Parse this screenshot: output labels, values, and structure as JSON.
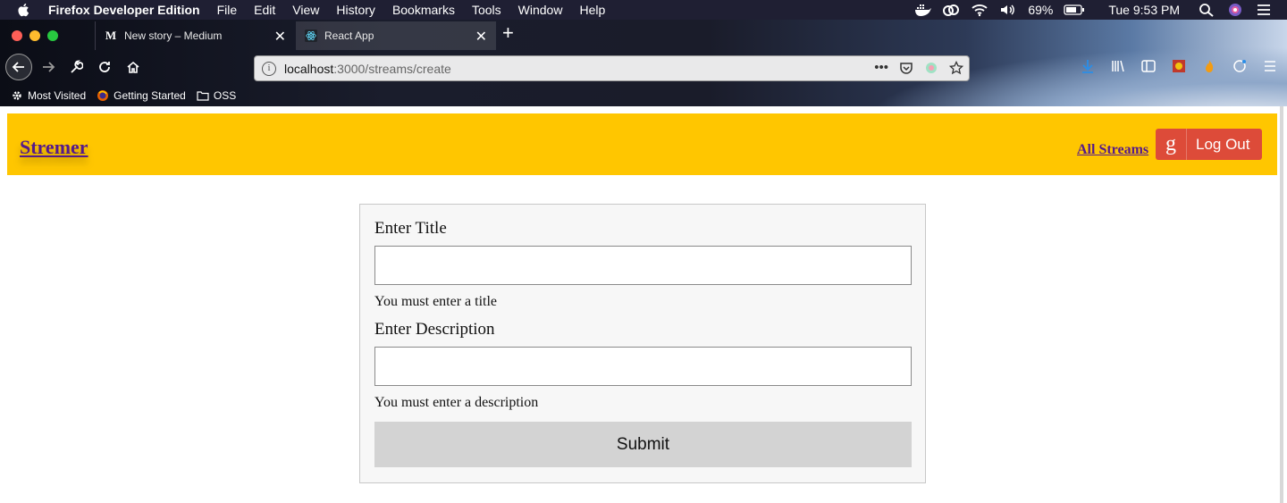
{
  "menubar": {
    "app_name": "Firefox Developer Edition",
    "items": [
      "File",
      "Edit",
      "View",
      "History",
      "Bookmarks",
      "Tools",
      "Window",
      "Help"
    ],
    "battery": "69%",
    "clock": "Tue 9:53 PM"
  },
  "browser": {
    "tabs": [
      {
        "title": "New story – Medium",
        "favicon": "M",
        "active": false
      },
      {
        "title": "React App",
        "favicon": "react-icon",
        "active": true
      }
    ],
    "url": {
      "host": "localhost",
      "path": ":3000/streams/create"
    },
    "bookmarks": [
      {
        "label": "Most Visited",
        "icon": "gear-icon"
      },
      {
        "label": "Getting Started",
        "icon": "firefox-icon"
      },
      {
        "label": "OSS",
        "icon": "folder-icon"
      }
    ]
  },
  "header": {
    "brand": "Stremer",
    "nav_link": "All Streams",
    "logout_label": "Log Out",
    "google_glyph": "g"
  },
  "form": {
    "title_label": "Enter Title",
    "title_value": "",
    "title_error": "You must enter a title",
    "description_label": "Enter Description",
    "description_value": "",
    "description_error": "You must enter a description",
    "submit_label": "Submit"
  },
  "colors": {
    "header_bg": "#ffc600",
    "link": "#551a8b",
    "google_button": "#dd4b39",
    "submit_bg": "#d3d3d3",
    "form_bg": "#f7f7f7"
  }
}
